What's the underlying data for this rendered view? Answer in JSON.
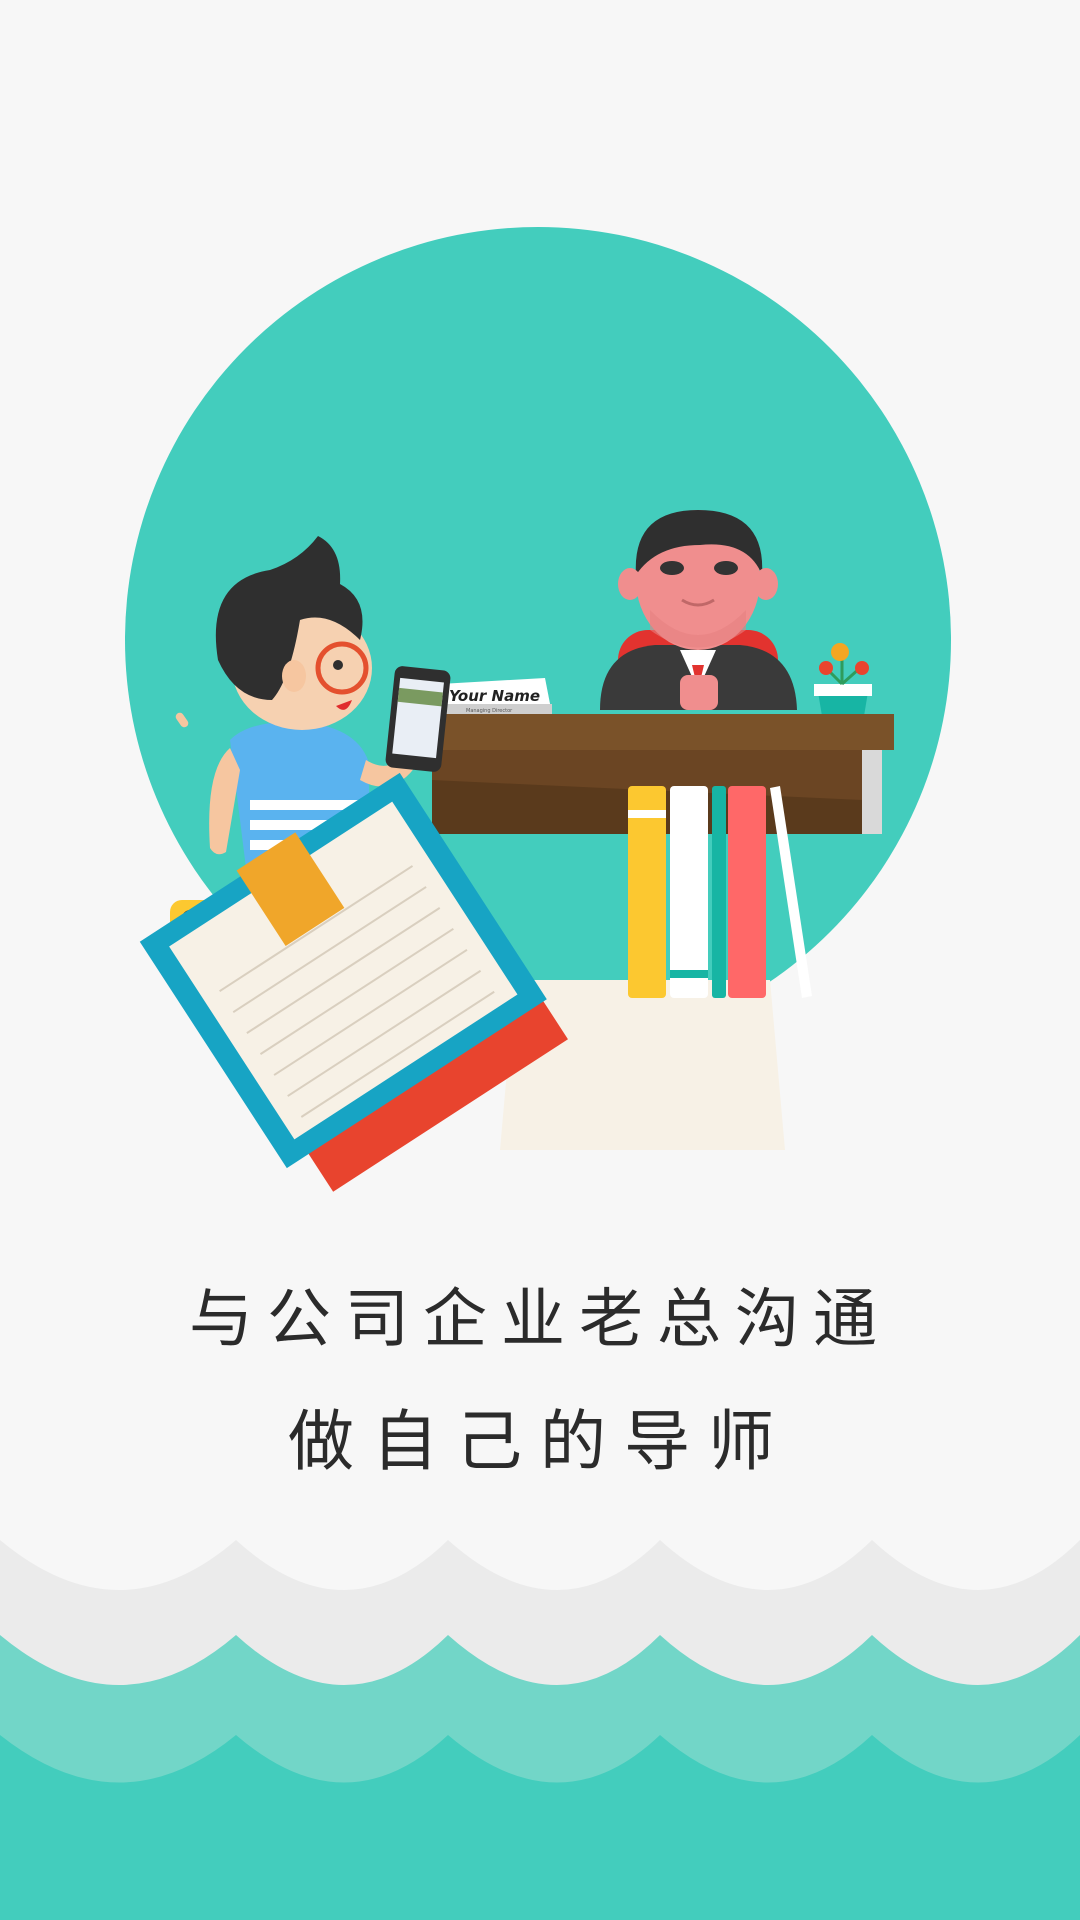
{
  "colors": {
    "background": "#f7f7f7",
    "teal": "#43cdbd",
    "teal_light": "#72d6c8",
    "wave_grey": "#ebebeb",
    "text": "#2b2b2b"
  },
  "illustration": {
    "name_plate": "Your Name",
    "name_plate_sub": "Managing Director"
  },
  "headline": {
    "line1": "与公司企业老总沟通",
    "line2": "做自己的导师"
  }
}
